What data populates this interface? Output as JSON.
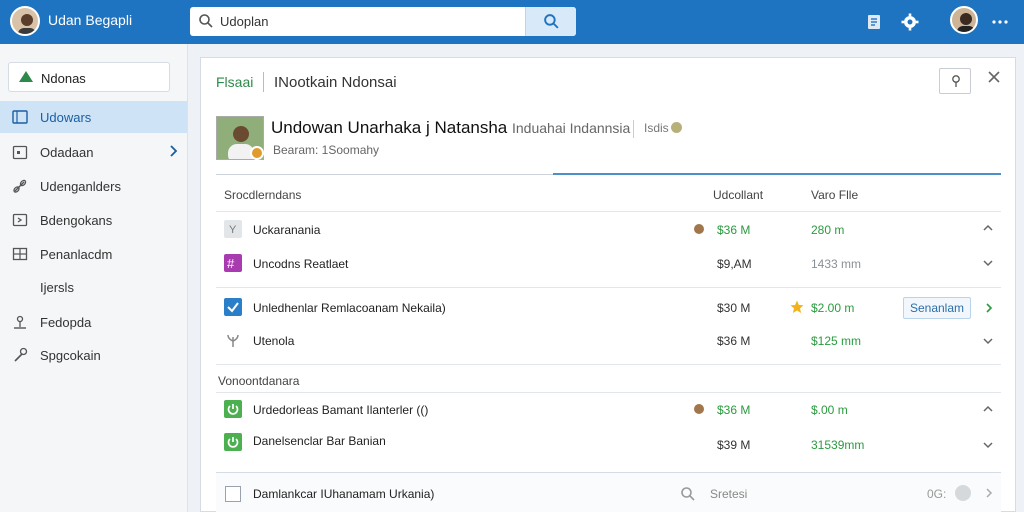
{
  "topbar": {
    "title": "Udan Begapli",
    "search_value": "Udoplan",
    "colors": {
      "bar": "#1f74c2"
    }
  },
  "sidebar": {
    "top_item": "Ndonas",
    "items": [
      {
        "label": "Udowars",
        "icon": "list-icon",
        "active": true
      },
      {
        "label": "Odadaan",
        "icon": "calendar-icon",
        "has_chevron": true
      },
      {
        "label": "Udenganlders",
        "icon": "link-icon"
      },
      {
        "label": "Bdengokans",
        "icon": "export-icon"
      },
      {
        "label": "Penanlacdm",
        "icon": "grid-icon"
      },
      {
        "label": "Ijersls",
        "icon": ""
      },
      {
        "label": "Fedopda",
        "icon": "user-icon"
      },
      {
        "label": "Spgcokain",
        "icon": "wrench-icon"
      }
    ]
  },
  "panel": {
    "tab_active": "Flsaai",
    "tab_title": "INootkain Ndonsai",
    "profile": {
      "name": "Undowan Unarhaka j Natansha",
      "name_sub": "Induahai Indannsia",
      "extra": "Isdis",
      "meta": "Bearam: 1Soomahy"
    },
    "columns": {
      "name": "Srocdlerndans",
      "c1": "Udcollant",
      "c2": "Varo Flle"
    },
    "rows": [
      {
        "name": "Uckaranania",
        "v1": "$36 M",
        "v2": "280 m",
        "v1_color": "green",
        "v2_color": "green",
        "chev": "up",
        "mark": "coin"
      },
      {
        "name": "Uncodns Reatlaet",
        "v1": "$9,AM",
        "v2": "1433 mm",
        "v1_color": "dark",
        "v2_color": "grey",
        "chev": "down",
        "mark": ""
      },
      {
        "name": "Unledhenlar Remlacoanam Nekaila)",
        "v1": "$30 M",
        "v2": "$2.00 m",
        "v1_color": "dark",
        "v2_color": "green",
        "chev": "right",
        "mark": "star",
        "button": "Senanlam"
      },
      {
        "name": "Utenola",
        "v1": "$36 M",
        "v2": "$125 mm",
        "v1_color": "dark",
        "v2_color": "green",
        "chev": "down",
        "mark": ""
      }
    ],
    "section2_title": "Vonoontdanara",
    "rows2": [
      {
        "name": "Urdedorleas Bamant Ilanterler (()",
        "v1": "$36 M",
        "v2": "$.00 m",
        "v1_color": "green",
        "v2_color": "green",
        "chev": "up",
        "mark": "coin"
      },
      {
        "name": "Danelsenclar Bar Banian",
        "v1": "$39 M",
        "v2": "31539mm",
        "v1_color": "dark",
        "v2_color": "green",
        "chev": "down",
        "mark": ""
      }
    ],
    "footer": {
      "label": "Damlankcar IUhanamam Urkania)",
      "search_label": "Sretesi",
      "count": "0G:"
    }
  }
}
